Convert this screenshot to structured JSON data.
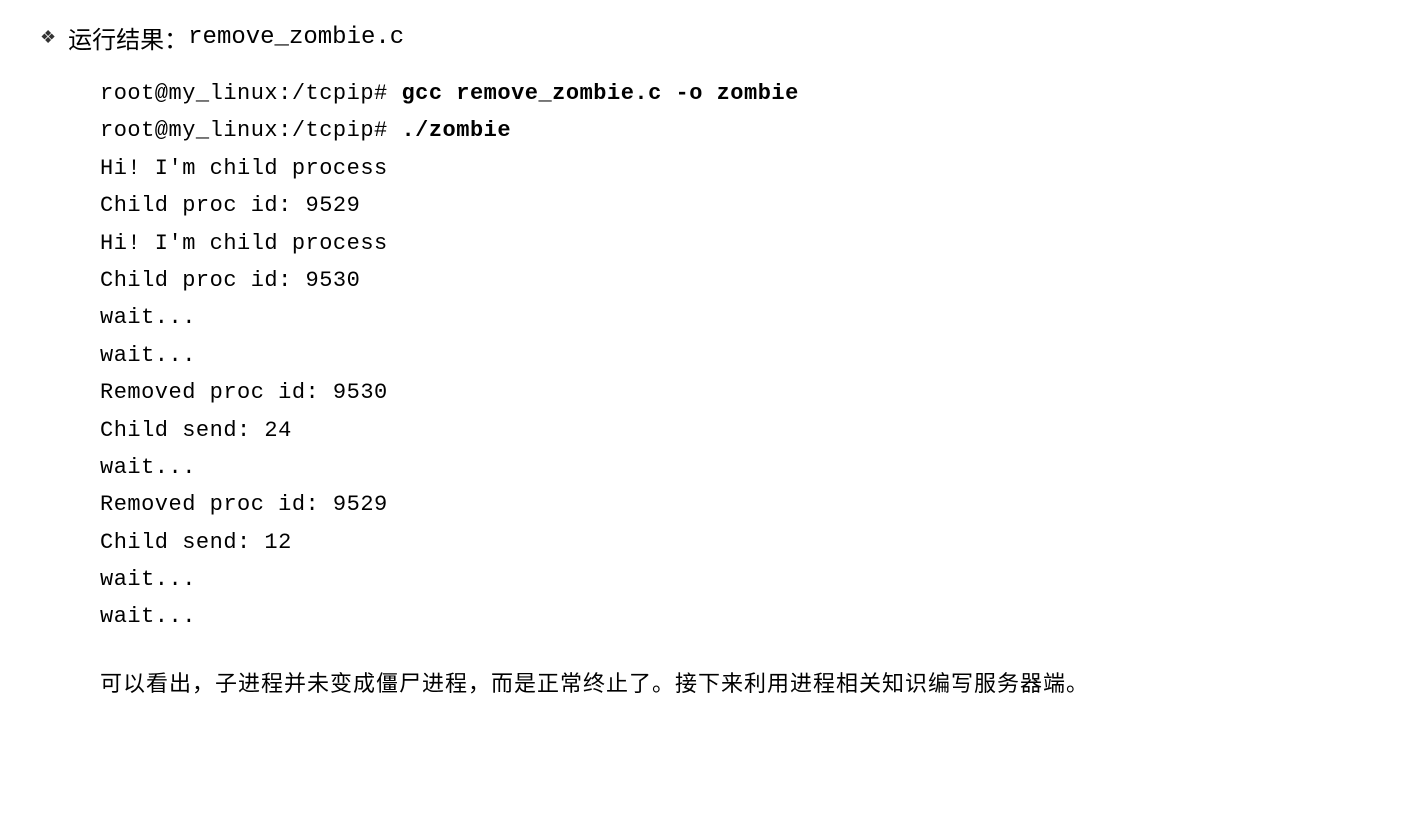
{
  "heading": {
    "bullet": "❖",
    "label": "运行结果：",
    "filename": "remove_zombie.c"
  },
  "terminal": {
    "prompt": "root@my_linux:/tcpip# ",
    "lines": [
      {
        "prompt": "root@my_linux:/tcpip# ",
        "cmd": "gcc remove_zombie.c -o zombie"
      },
      {
        "prompt": "root@my_linux:/tcpip# ",
        "cmd": "./zombie"
      },
      {
        "text": "Hi! I'm child process"
      },
      {
        "text": "Child proc id: 9529"
      },
      {
        "text": "Hi! I'm child process"
      },
      {
        "text": "Child proc id: 9530"
      },
      {
        "text": "wait..."
      },
      {
        "text": "wait..."
      },
      {
        "text": "Removed proc id: 9530"
      },
      {
        "text": "Child send: 24"
      },
      {
        "text": "wait..."
      },
      {
        "text": "Removed proc id: 9529"
      },
      {
        "text": "Child send: 12"
      },
      {
        "text": "wait..."
      },
      {
        "text": "wait..."
      }
    ]
  },
  "footer": "可以看出，子进程并未变成僵尸进程，而是正常终止了。接下来利用进程相关知识编写服务器端。"
}
